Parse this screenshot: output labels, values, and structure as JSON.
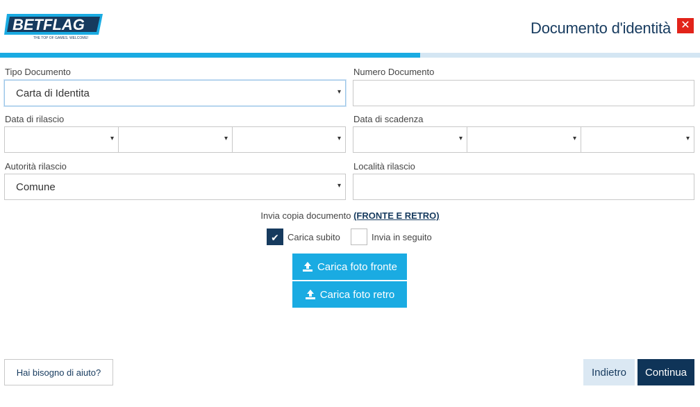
{
  "header": {
    "logo_text": "BETFLAG",
    "logo_tagline": "THE TOP OF GAMES. WELCOME!",
    "title": "Documento d'identità",
    "close_glyph": "✕"
  },
  "progress": {
    "fraction": 0.6
  },
  "form": {
    "tipo_documento": {
      "label": "Tipo Documento",
      "value": "Carta di Identita"
    },
    "numero_documento": {
      "label": "Numero Documento",
      "value": ""
    },
    "data_rilascio": {
      "label": "Data di rilascio",
      "day": "",
      "month": "",
      "year": ""
    },
    "data_scadenza": {
      "label": "Data di scadenza",
      "day": "",
      "month": "",
      "year": ""
    },
    "autorita_rilascio": {
      "label": "Autorità rilascio",
      "value": "Comune"
    },
    "localita_rilascio": {
      "label": "Località rilascio",
      "value": ""
    }
  },
  "upload": {
    "note_prefix": "Invia copia documento ",
    "note_link": "(FRONTE E RETRO)",
    "options": [
      {
        "label": "Carica subito",
        "checked": true
      },
      {
        "label": "Invia in seguito",
        "checked": false
      }
    ],
    "front_button": "Carica foto fronte",
    "back_button": "Carica foto retro"
  },
  "footer": {
    "help": "Hai bisogno di aiuto?",
    "back": "Indietro",
    "next": "Continua"
  },
  "colors": {
    "brand_navy": "#163a5e",
    "accent_blue": "#1aabe2",
    "close_red": "#e2231a"
  },
  "icons": {
    "caret": "▾",
    "check": "✔",
    "upload": "upload-icon"
  }
}
